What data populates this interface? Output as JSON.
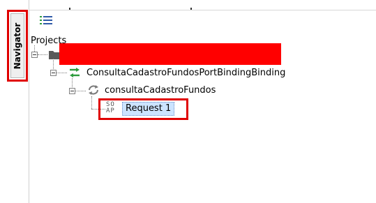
{
  "navigator": {
    "tab_label": "Navigator"
  },
  "tree": {
    "root_label": "Projects",
    "binding_label": "ConsultaCadastroFundosPortBindingBinding",
    "operation_label": "consultaCadastroFundos",
    "request_label": "Request 1",
    "soap_icon_text": [
      "SO",
      "AP"
    ]
  },
  "colors": {
    "highlight_border": "#e00000",
    "redaction": "#ff0000",
    "selection": "#cce4ff",
    "binding_icon": "#2c9b3c",
    "toolbar_icon_blue": "#2f5aa8"
  }
}
